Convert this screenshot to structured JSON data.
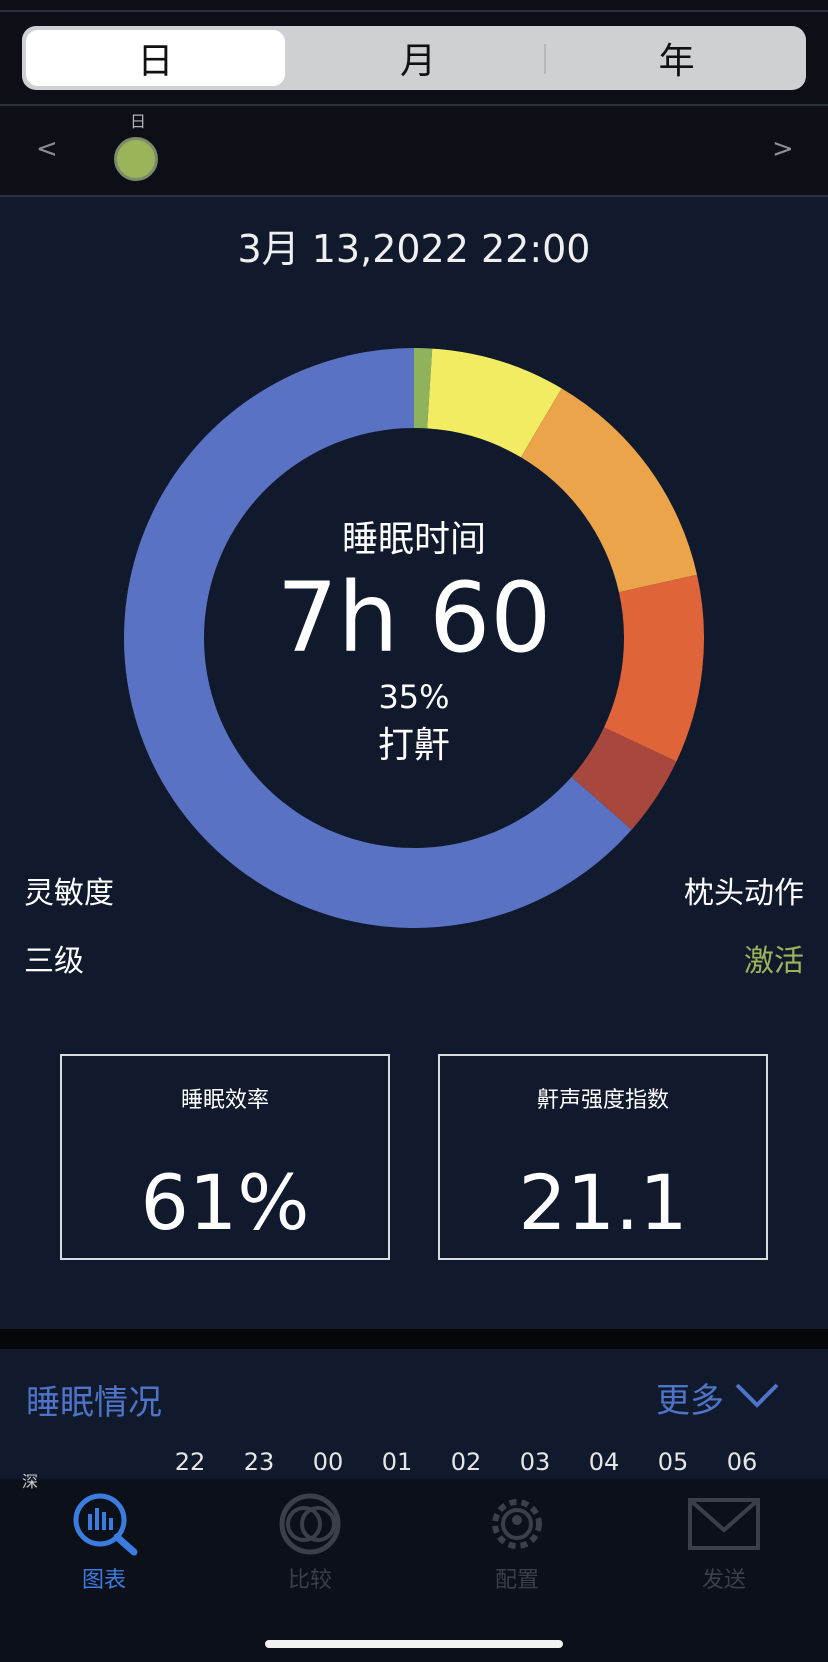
{
  "segments": {
    "day": "日",
    "month": "月",
    "year": "年"
  },
  "date_nav": {
    "prev": "<",
    "next": ">",
    "day_marker_label": "日"
  },
  "date_title": "3月 13,2022 22:00",
  "donut": {
    "center_title": "睡眠时间",
    "center_value": "7h 60",
    "snore_percent": "35%",
    "snore_label": "打鼾"
  },
  "chart_data": {
    "type": "pie",
    "values": [
      1.0,
      7.5,
      13.0,
      10.5,
      4.5,
      63.5
    ],
    "colors": [
      "#8eb35c",
      "#f2ec63",
      "#eba449",
      "#e0643a",
      "#a8473e",
      "#5a72c4"
    ]
  },
  "sensitivity": {
    "label": "灵敏度",
    "value": "三级"
  },
  "pillow_motion": {
    "label": "枕头动作",
    "value": "激活"
  },
  "metrics": {
    "efficiency": {
      "title": "睡眠效率",
      "value": "61%"
    },
    "snore_index": {
      "title": "鼾声强度指数",
      "value": "21.1"
    }
  },
  "sleep_status": {
    "title": "睡眠情况",
    "more": "更多",
    "partial_row_label": "深",
    "hours": [
      "22",
      "23",
      "00",
      "01",
      "02",
      "03",
      "04",
      "05",
      "06"
    ]
  },
  "tabs": [
    {
      "label": "图表",
      "icon": "chart-search-icon",
      "color": "#3b7ce0"
    },
    {
      "label": "比较",
      "icon": "compare-icon",
      "color": "#3a3f48"
    },
    {
      "label": "配置",
      "icon": "settings-gear-icon",
      "color": "#3a3f48"
    },
    {
      "label": "发送",
      "icon": "mail-icon",
      "color": "#3a3f48"
    }
  ]
}
